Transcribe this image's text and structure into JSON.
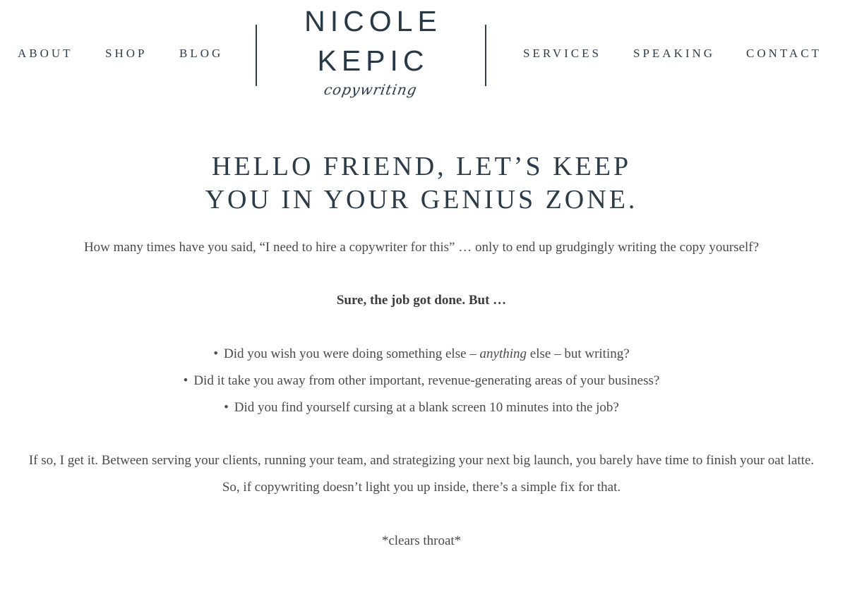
{
  "nav": {
    "left": [
      "ABOUT",
      "SHOP",
      "BLOG"
    ],
    "right": [
      "SERVICES",
      "SPEAKING",
      "CONTACT"
    ]
  },
  "logo": {
    "line1": "NICOLE",
    "line2": "KEPIC",
    "script": "copywriting"
  },
  "content": {
    "heading_line1": "HELLO FRIEND, LET’S KEEP",
    "heading_line2": "YOU IN YOUR GENIUS ZONE.",
    "intro": "How many times have you said, “I need to hire a copywriter for this” … only to end up grudgingly writing the copy yourself?",
    "emphasis": "Sure, the job got done. But …",
    "bullets": [
      {
        "before": "Did you wish you were doing something else – ",
        "italic": "anything",
        "after": " else – but writing?"
      },
      {
        "before": "Did it take you away from other important, revenue-generating areas of your business?",
        "italic": "",
        "after": ""
      },
      {
        "before": "Did you find yourself cursing at a blank screen 10 minutes into the job?",
        "italic": "",
        "after": ""
      }
    ],
    "bullet_glyph": "•",
    "closing": "If so, I get it. Between serving your clients, running your team, and strategizing your next big launch, you barely have time to finish your oat latte. So, if copywriting doesn’t light you up inside, there’s a simple fix for that.",
    "aside": "*clears throat*"
  },
  "colors": {
    "brand_navy": "#273848",
    "body_text": "#4a4a4a"
  }
}
